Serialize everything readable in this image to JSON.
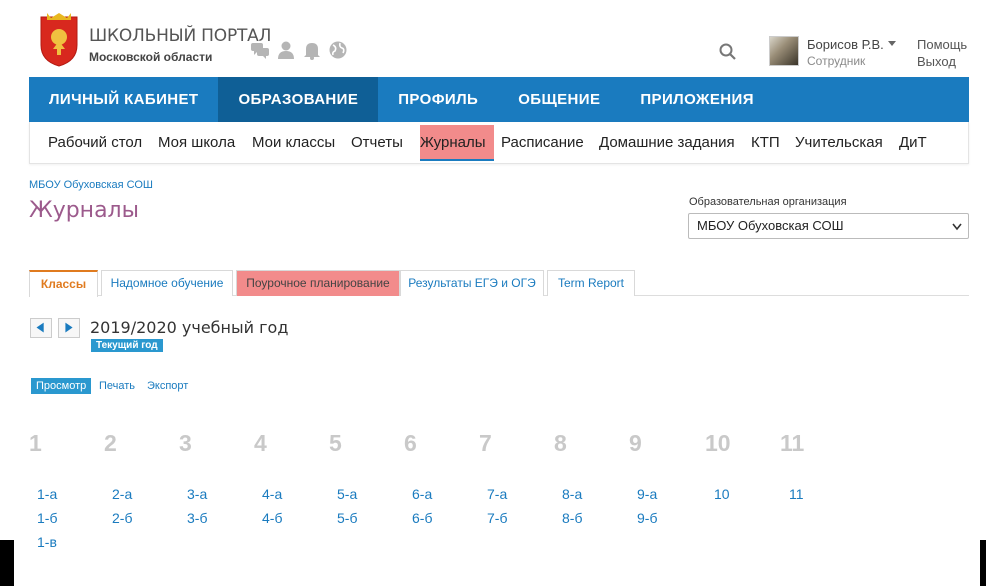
{
  "header": {
    "brand_title": "ШКОЛЬНЫЙ ПОРТАЛ",
    "brand_subtitle": "Московской области",
    "icons": [
      "chat-icon",
      "user-icon",
      "bell-icon",
      "globe-icon"
    ],
    "user_name": "Борисов Р.В.",
    "user_role": "Сотрудник",
    "help": "Помощь",
    "exit": "Выход"
  },
  "topnav": {
    "items": [
      "ЛИЧНЫЙ КАБИНЕТ",
      "ОБРАЗОВАНИЕ",
      "ПРОФИЛЬ",
      "ОБЩЕНИЕ",
      "ПРИЛОЖЕНИЯ"
    ],
    "active": "ОБРАЗОВАНИЕ"
  },
  "subnav": {
    "items": [
      "Рабочий стол",
      "Моя школа",
      "Мои классы",
      "Отчеты",
      "Журналы",
      "Расписание",
      "Домашние задания",
      "КТП",
      "Учительская",
      "ДиТ"
    ],
    "active": "Журналы"
  },
  "breadcrumb": "МБОУ Обуховская СОШ",
  "page_title": "Журналы",
  "org": {
    "label": "Образовательная организация",
    "selected": "МБОУ Обуховская СОШ"
  },
  "tabs": [
    "Классы",
    "Надомное обучение",
    "Поурочное планирование",
    "Результаты ЕГЭ и ОГЭ",
    "Term Report"
  ],
  "year": {
    "text": "2019/2020 учебный год",
    "badge": "Текущий год"
  },
  "actions": {
    "view": "Просмотр",
    "print": "Печать",
    "export": "Экспорт"
  },
  "grades": [
    {
      "num": "1",
      "classes": [
        "1-а",
        "1-б",
        "1-в"
      ]
    },
    {
      "num": "2",
      "classes": [
        "2-а",
        "2-б"
      ]
    },
    {
      "num": "3",
      "classes": [
        "3-а",
        "3-б"
      ]
    },
    {
      "num": "4",
      "classes": [
        "4-а",
        "4-б"
      ]
    },
    {
      "num": "5",
      "classes": [
        "5-а",
        "5-б"
      ]
    },
    {
      "num": "6",
      "classes": [
        "6-а",
        "6-б"
      ]
    },
    {
      "num": "7",
      "classes": [
        "7-а",
        "7-б"
      ]
    },
    {
      "num": "8",
      "classes": [
        "8-а",
        "8-б"
      ]
    },
    {
      "num": "9",
      "classes": [
        "9-а",
        "9-б"
      ]
    },
    {
      "num": "10",
      "classes": [
        "10"
      ]
    },
    {
      "num": "11",
      "classes": [
        "11"
      ]
    }
  ],
  "colors": {
    "primary": "#1a7bbf",
    "nav_active": "#0f5f96",
    "highlight": "#f28b8b",
    "title": "#9c5a8c",
    "tab_active": "#e07b1f"
  }
}
